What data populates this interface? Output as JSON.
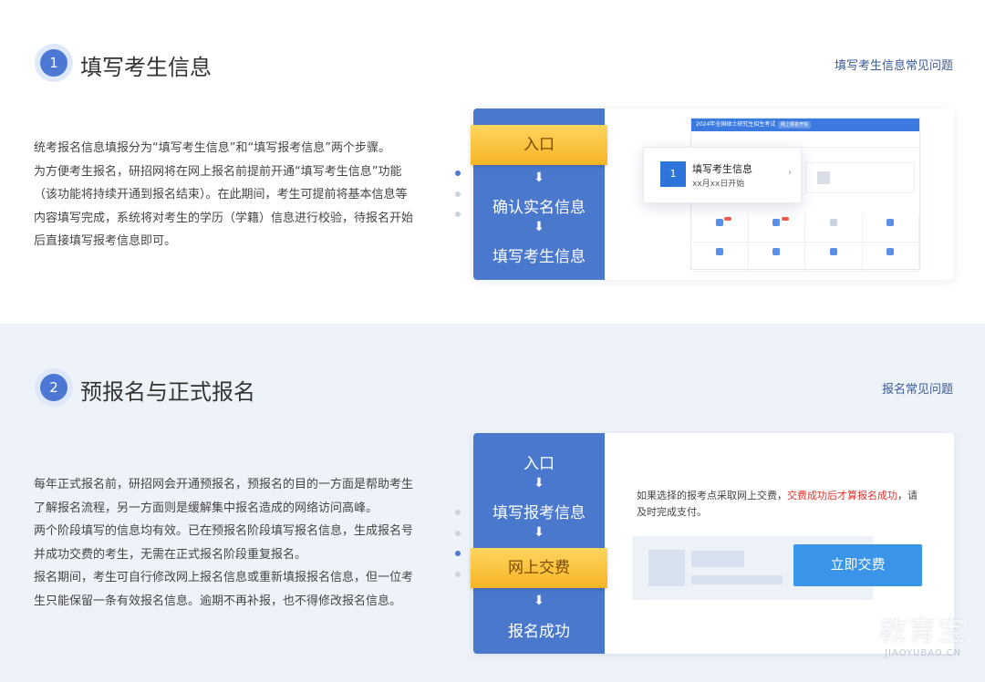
{
  "step1": {
    "number": "1",
    "title": "填写考生信息",
    "faq_link": "填写考生信息常见问题",
    "description": [
      "统考报名信息填报分为“填写考生信息”和“填写报考信息”两个步骤。",
      "为方便考生报名，研招网将在网上报名前提前开通“填写考生信息”功能",
      "（该功能将持续开通到报名结束）。在此期间，考生可提前将基本信息等",
      "内容填写完成，系统将对考生的学历（学籍）信息进行校验，待报名开始",
      "后直接填写报考信息即可。"
    ],
    "flow": [
      "入口",
      "确认实名信息",
      "填写考生信息"
    ],
    "arrow_glyph": "⬇",
    "popup": {
      "number": "1",
      "title": "填写考生信息",
      "subtitle": "xx月xx日开始"
    },
    "mini_header": "2024年全国硕士研究生招生考试",
    "mini_tag": "网上报名开始"
  },
  "step2": {
    "number": "2",
    "title": "预报名与正式报名",
    "faq_link": "报名常见问题",
    "description": [
      "每年正式报名前，研招网会开通预报名，预报名的目的一方面是帮助考生",
      "了解报名流程，另一方面则是缓解集中报名造成的网络访问高峰。",
      "两个阶段填写的信息均有效。已在预报名阶段填写报名信息，生成报名号",
      "并成功交费的考生，无需在正式报名阶段重复报名。",
      "报名期间，考生可自行修改网上报名信息或重新填报报名信息，但一位考",
      "生只能保留一条有效报名信息。逾期不再补报，也不得修改报名信息。"
    ],
    "flow": [
      "入口",
      "填写报考信息",
      "网上交费",
      "报名成功"
    ],
    "notice_prefix": "如果选择的报考点采取网上交费，",
    "notice_red": "交费成功后才算报名成功",
    "notice_suffix": "，请及时完成支付。",
    "pay_button": "立即交费"
  },
  "watermark": {
    "line1": "教育宝",
    "line2": "JIAOYUBAO.CN"
  }
}
